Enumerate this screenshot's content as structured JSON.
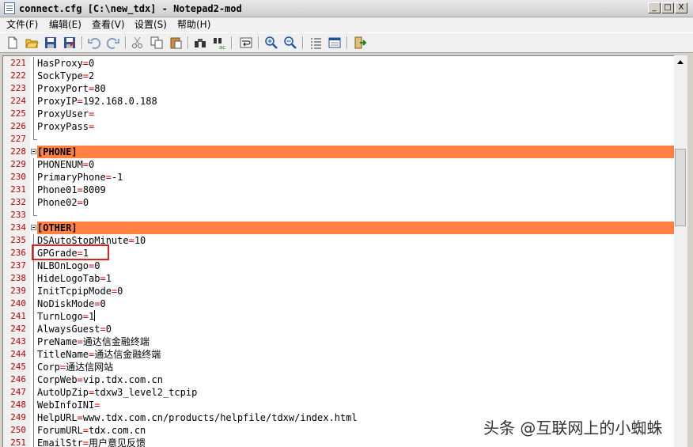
{
  "window": {
    "title": "connect.cfg [C:\\new_tdx] - Notepad2-mod",
    "controls": {
      "minimize": "_",
      "maximize": "□",
      "close": "X"
    }
  },
  "menu": [
    "文件(F)",
    "编辑(E)",
    "查看(V)",
    "设置(S)",
    "帮助(H)"
  ],
  "toolbar": [
    {
      "name": "new-file-icon"
    },
    {
      "name": "open-folder-icon"
    },
    {
      "name": "save-icon"
    },
    {
      "name": "save-as-icon"
    },
    {
      "name": "undo-icon"
    },
    {
      "name": "redo-icon"
    },
    {
      "name": "cut-icon"
    },
    {
      "name": "copy-icon"
    },
    {
      "name": "paste-icon"
    },
    {
      "name": "find-icon"
    },
    {
      "name": "replace-icon"
    },
    {
      "name": "word-wrap-icon"
    },
    {
      "name": "zoom-in-icon"
    },
    {
      "name": "zoom-out-icon"
    },
    {
      "name": "scheme-icon"
    },
    {
      "name": "customize-icon"
    },
    {
      "name": "exit-icon"
    }
  ],
  "editor": {
    "lines": [
      {
        "num": "221",
        "key": "HasProxy",
        "val": "0"
      },
      {
        "num": "222",
        "key": "SockType",
        "val": "2"
      },
      {
        "num": "223",
        "key": "ProxyPort",
        "val": "80"
      },
      {
        "num": "224",
        "key": "ProxyIP",
        "val": "192.168.0.188"
      },
      {
        "num": "225",
        "key": "ProxyUser",
        "val": ""
      },
      {
        "num": "226",
        "key": "ProxyPass",
        "val": ""
      },
      {
        "num": "227",
        "text": "",
        "fold": "end"
      },
      {
        "num": "228",
        "section": "[PHONE]"
      },
      {
        "num": "229",
        "key": "PHONENUM",
        "val": "0"
      },
      {
        "num": "230",
        "key": "PrimaryPhone",
        "val": "-1"
      },
      {
        "num": "231",
        "key": "Phone01",
        "val": "8009"
      },
      {
        "num": "232",
        "key": "Phone02",
        "val": "0"
      },
      {
        "num": "233",
        "text": "",
        "fold": "end"
      },
      {
        "num": "234",
        "section": "[OTHER]"
      },
      {
        "num": "235",
        "key": "DSAutoStopMinute",
        "val": "10"
      },
      {
        "num": "236",
        "key": "GPGrade",
        "val": "1"
      },
      {
        "num": "237",
        "key": "NLBOnLogo",
        "val": "0"
      },
      {
        "num": "238",
        "key": "HideLogoTab",
        "val": "1"
      },
      {
        "num": "239",
        "key": "InitTcpipMode",
        "val": "0"
      },
      {
        "num": "240",
        "key": "NoDiskMode",
        "val": "0"
      },
      {
        "num": "241",
        "key": "TurnLogo",
        "val": "1",
        "caret": true
      },
      {
        "num": "242",
        "key": "AlwaysGuest",
        "val": "0"
      },
      {
        "num": "243",
        "key": "PreName",
        "val": "通达信金融终端"
      },
      {
        "num": "244",
        "key": "TitleName",
        "val": "通达信金融终端"
      },
      {
        "num": "245",
        "key": "Corp",
        "val": "通达信网站"
      },
      {
        "num": "246",
        "key": "CorpWeb",
        "val": "vip.tdx.com.cn"
      },
      {
        "num": "247",
        "key": "AutoUpZip",
        "val": "tdxw3_level2_tcpip"
      },
      {
        "num": "248",
        "key": "WebInfoINI",
        "val": ""
      },
      {
        "num": "249",
        "key": "HelpURL",
        "val": "www.tdx.com.cn/products/helpfile/tdxw/index.html"
      },
      {
        "num": "250",
        "key": "ForumURL",
        "val": "tdx.com.cn"
      },
      {
        "num": "251",
        "key": "EmailStr",
        "val": "用户意见反馈"
      }
    ]
  },
  "watermark": "头条 @互联网上的小蜘蛛",
  "colors": {
    "section_highlight": "#ff8040",
    "line_number": "#c00000",
    "equals": "#d00000",
    "annotation_box": "#e02020"
  }
}
